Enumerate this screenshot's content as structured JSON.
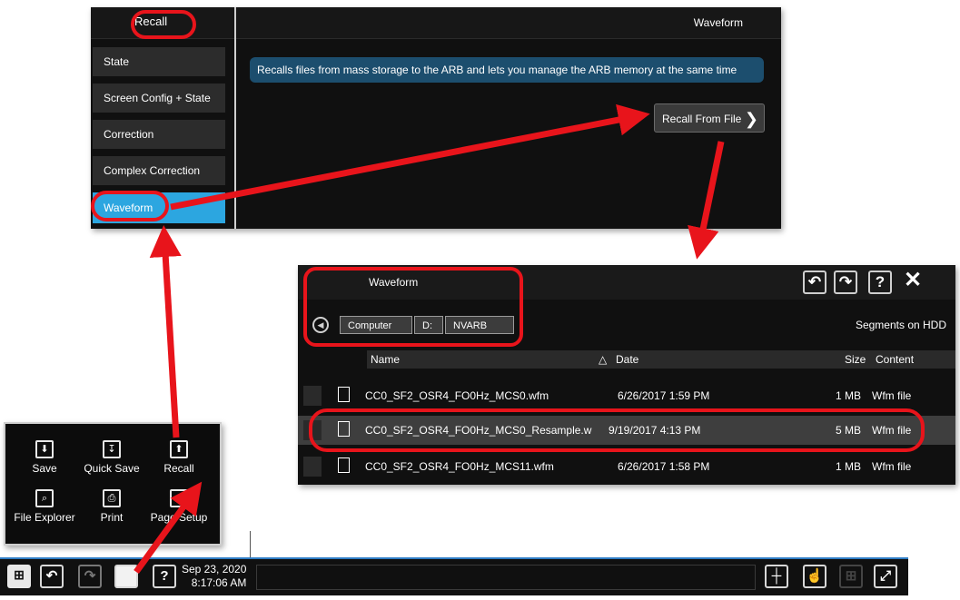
{
  "recall_panel": {
    "header_left": "Recall",
    "header_right": "Waveform",
    "menu": [
      {
        "label": "State"
      },
      {
        "label": "Screen Config + State"
      },
      {
        "label": "Correction"
      },
      {
        "label": "Complex Correction"
      },
      {
        "label": "Waveform",
        "active": true
      }
    ],
    "info_text": "Recalls files from mass storage to the ARB and lets you manage the ARB memory at the same time",
    "recall_from_file_label": "Recall From File"
  },
  "file_browser": {
    "title": "Waveform",
    "toolbar_icons": [
      "undo-icon",
      "redo-icon",
      "help-icon",
      "close-icon"
    ],
    "path": [
      "Computer",
      "D:",
      "NVARB"
    ],
    "segments_label": "Segments on HDD",
    "columns": {
      "name": "Name",
      "date": "Date",
      "size": "Size",
      "content": "Content"
    },
    "sort_indicator": "△",
    "files": [
      {
        "name": "CC0_SF2_OSR4_FO0Hz_MCS0.wfm",
        "date": "6/26/2017 1:59 PM",
        "size": "1 MB",
        "content": "Wfm file"
      },
      {
        "name": "CC0_SF2_OSR4_FO0Hz_MCS0_Resample.w",
        "date": "9/19/2017 4:13 PM",
        "size": "5 MB",
        "content": "Wfm file",
        "selected": true
      },
      {
        "name": "CC0_SF2_OSR4_FO0Hz_MCS11.wfm",
        "date": "6/26/2017 1:58 PM",
        "size": "1 MB",
        "content": "Wfm file"
      }
    ]
  },
  "file_menu": {
    "items": [
      {
        "label": "Save",
        "icon": "save-icon"
      },
      {
        "label": "Quick Save",
        "icon": "quick-save-icon"
      },
      {
        "label": "Recall",
        "icon": "recall-icon"
      },
      {
        "label": "File Explorer",
        "icon": "file-explorer-icon"
      },
      {
        "label": "Print",
        "icon": "print-icon"
      },
      {
        "label": "Page Setup",
        "icon": "page-setup-icon"
      }
    ]
  },
  "taskbar": {
    "date": "Sep 23, 2020",
    "time": "8:17:06 AM",
    "icons": [
      "windows-icon",
      "undo-icon",
      "redo-icon",
      "file-icon",
      "help-icon",
      "layout-icon",
      "touch-icon",
      "grid-icon",
      "fullscreen-icon"
    ]
  },
  "colors": {
    "accent": "#2ca6e0",
    "info_box": "#1c4e6e",
    "annotation": "#e8141b",
    "taskbar_border": "#2e7cc4"
  }
}
